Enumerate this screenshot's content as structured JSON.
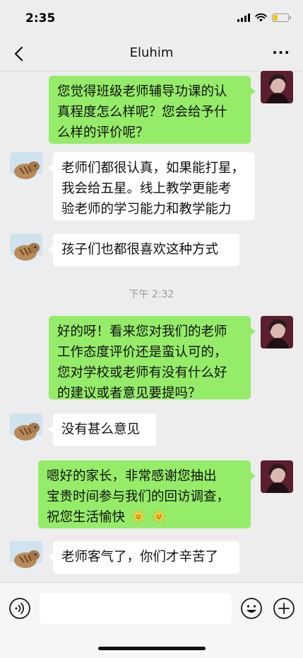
{
  "status_bar": {
    "time": "2:35",
    "battery_level": 0.3
  },
  "header": {
    "title": "Eluhim"
  },
  "messages": [
    {
      "side": "right",
      "lines": [
        "您觉得班级老师辅导功课的认",
        "真程度怎么样呢？您会给予什",
        "么样的评价呢？"
      ]
    },
    {
      "side": "left",
      "lines": [
        "老师们都很认真，如果能打星，",
        "我会给五星。线上教学更能考",
        "验老师的学习能力和教学能力"
      ]
    },
    {
      "side": "left",
      "lines": [
        "孩子们也都很喜欢这种方式"
      ]
    },
    {
      "side": "right",
      "lines": [
        "好的呀！看来您对我们的老师",
        "工作态度评价还是蛮认可的，",
        "您对学校或老师有没有什么好",
        "的建议或者意见要提吗？"
      ]
    },
    {
      "side": "left",
      "lines": [
        "没有甚么意见"
      ]
    },
    {
      "side": "right",
      "lines": [
        "嗯好的家长，非常感谢您抽出",
        "宝贵时间参与我们的回访调查，",
        "祝您生活愉快"
      ],
      "emoji": [
        "sun-face-emoji",
        "sun-face-emoji"
      ]
    },
    {
      "side": "left",
      "lines": [
        "老师客气了，你们才辛苦了"
      ]
    }
  ],
  "timestamp": "下午 2:32",
  "input_bar": {
    "placeholder": ""
  },
  "colors": {
    "background": "#ededed",
    "outgoing_bubble": "#95ec69",
    "incoming_bubble": "#ffffff",
    "timestamp": "#9a9a9a"
  },
  "icons": {
    "back": "chevron-left-icon",
    "more": "more-dots-icon",
    "voice": "voice-icon",
    "emoji": "emoji-smile-icon",
    "plus": "plus-icon"
  }
}
